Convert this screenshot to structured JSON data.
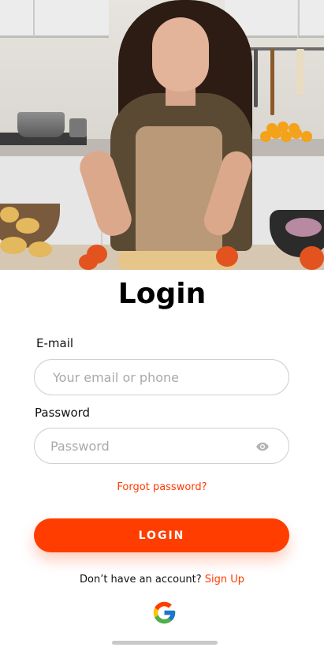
{
  "hero": {
    "image": "woman-cooking-in-kitchen-photo"
  },
  "title": "Login",
  "email": {
    "label": "E-mail",
    "placeholder": "Your email or phone",
    "value": ""
  },
  "password": {
    "label": "Password",
    "placeholder": "Password",
    "value": "",
    "toggle_icon": "eye-icon"
  },
  "forgot_label": "Forgot password?",
  "login_label": "LOGIN",
  "signup": {
    "prompt": "Don’t have an account?",
    "link": "Sign Up"
  },
  "social": {
    "icon": "google-icon"
  },
  "colors": {
    "accent": "#ff3d00",
    "link": "#ff3b00",
    "border": "#cfcfcf",
    "placeholder": "#a9a9a9"
  }
}
